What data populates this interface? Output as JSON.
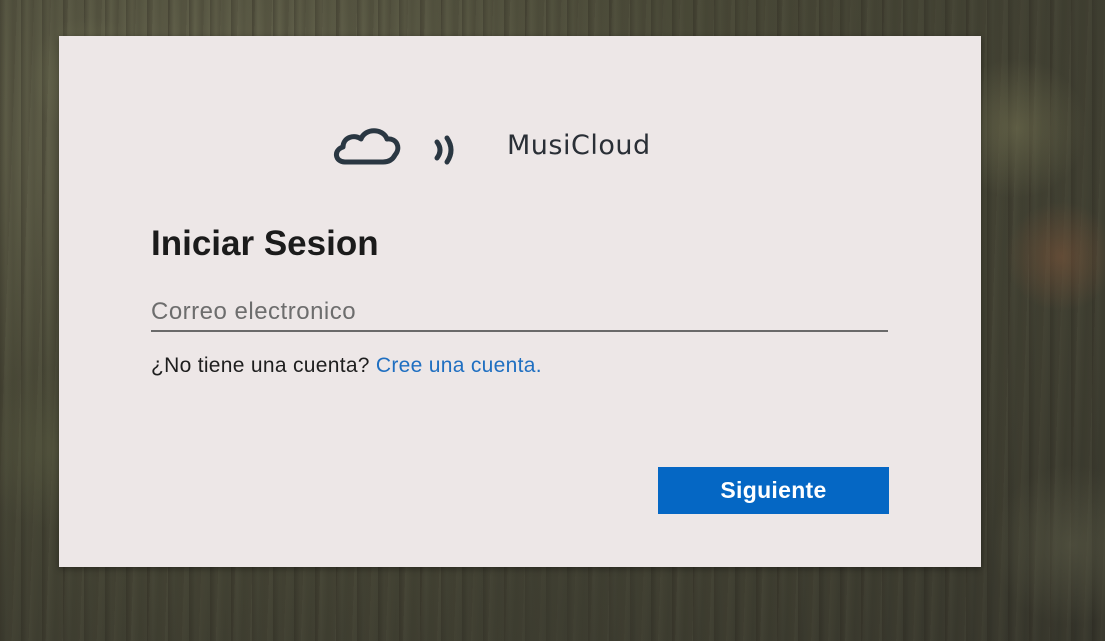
{
  "brand": {
    "name": "MusiCloud",
    "logo_icon": "cloud-sound-icon",
    "logo_color": "#2a3742"
  },
  "login": {
    "title": "Iniciar Sesion",
    "email_placeholder": "Correo electronico",
    "email_value": "",
    "signup_prompt": "¿No tiene una cuenta?",
    "signup_link": "Cree una cuenta.",
    "next_label": "Siguiente"
  },
  "colors": {
    "card_bg": "#ede7e7",
    "link": "#1f6fc1",
    "button_bg": "#0567c4",
    "button_text": "#ffffff"
  }
}
